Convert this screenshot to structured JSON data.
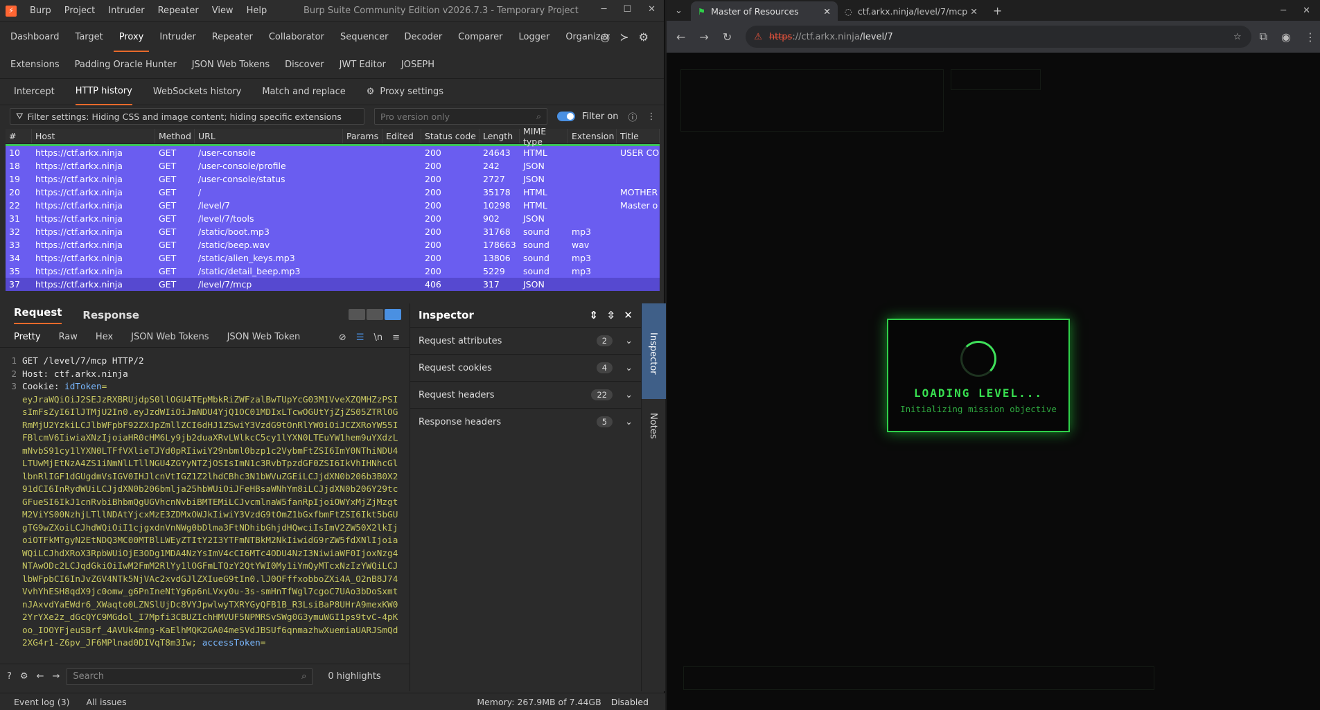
{
  "burp": {
    "title": "Burp Suite Community Edition v2026.7.3 - Temporary Project",
    "menu": [
      "Burp",
      "Project",
      "Intruder",
      "Repeater",
      "View",
      "Help"
    ],
    "main_tabs": [
      "Dashboard",
      "Target",
      "Proxy",
      "Intruder",
      "Repeater",
      "Collaborator",
      "Sequencer",
      "Decoder",
      "Comparer",
      "Logger",
      "Organizer"
    ],
    "ext_tabs": [
      "Extensions",
      "Padding Oracle Hunter",
      "JSON Web Tokens",
      "Discover",
      "JWT Editor",
      "JOSEPH"
    ],
    "proxy_tabs": [
      "Intercept",
      "HTTP history",
      "WebSockets history",
      "Match and replace",
      "Proxy settings"
    ],
    "filter_text": "Filter settings: Hiding CSS and image content; hiding specific extensions",
    "pro_placeholder": "Pro version only",
    "filter_on": "Filter on",
    "columns": [
      "#",
      "Host",
      "Method",
      "URL",
      "Params",
      "Edited",
      "Status code",
      "Length",
      "MIME type",
      "Extension",
      "Title"
    ],
    "rows": [
      [
        "10",
        "https://ctf.arkx.ninja",
        "GET",
        "/user-console",
        "",
        "",
        "200",
        "24643",
        "HTML",
        "",
        "USER CO"
      ],
      [
        "18",
        "https://ctf.arkx.ninja",
        "GET",
        "/user-console/profile",
        "",
        "",
        "200",
        "242",
        "JSON",
        "",
        ""
      ],
      [
        "19",
        "https://ctf.arkx.ninja",
        "GET",
        "/user-console/status",
        "",
        "",
        "200",
        "2727",
        "JSON",
        "",
        ""
      ],
      [
        "20",
        "https://ctf.arkx.ninja",
        "GET",
        "/",
        "",
        "",
        "200",
        "35178",
        "HTML",
        "",
        "MOTHER"
      ],
      [
        "22",
        "https://ctf.arkx.ninja",
        "GET",
        "/level/7",
        "",
        "",
        "200",
        "10298",
        "HTML",
        "",
        "Master o"
      ],
      [
        "31",
        "https://ctf.arkx.ninja",
        "GET",
        "/level/7/tools",
        "",
        "",
        "200",
        "902",
        "JSON",
        "",
        ""
      ],
      [
        "32",
        "https://ctf.arkx.ninja",
        "GET",
        "/static/boot.mp3",
        "",
        "",
        "200",
        "31768",
        "sound",
        "mp3",
        ""
      ],
      [
        "33",
        "https://ctf.arkx.ninja",
        "GET",
        "/static/beep.wav",
        "",
        "",
        "200",
        "178663",
        "sound",
        "wav",
        ""
      ],
      [
        "34",
        "https://ctf.arkx.ninja",
        "GET",
        "/static/alien_keys.mp3",
        "",
        "",
        "200",
        "13806",
        "sound",
        "mp3",
        ""
      ],
      [
        "35",
        "https://ctf.arkx.ninja",
        "GET",
        "/static/detail_beep.mp3",
        "",
        "",
        "200",
        "5229",
        "sound",
        "mp3",
        ""
      ],
      [
        "37",
        "https://ctf.arkx.ninja",
        "GET",
        "/level/7/mcp",
        "",
        "",
        "406",
        "317",
        "JSON",
        "",
        ""
      ]
    ],
    "req_tabs": [
      "Request",
      "Response"
    ],
    "format_tabs": [
      "Pretty",
      "Raw",
      "Hex",
      "JSON Web Tokens",
      "JSON Web Token"
    ],
    "code_lines": {
      "l1": "GET /level/7/mcp HTTP/2",
      "l2": "Host: ctf.arkx.ninja",
      "l3k": "Cookie: ",
      "l3n": "idToken",
      "l3v": "=\neyJraWQiOiJ2SEJzRXBRUjdpS0llOGU4TEpMbkRiZWFzalBwTUpYcG03M1VveXZQMHZzPSIsImFsZyI6IlJTMjU2In0.eyJzdWIiOiJmNDU4YjQ1OC01MDIxLTcwOGUtYjZjZS05ZTRlOGRmMjU2YzkiLCJlbWFpbF92ZXJpZmllZCI6dHJ1ZSwiY3VzdG9tOnRlYW0iOiJCZXRoYW55IFBlcmV6IiwiaXNzIjoiaHR0cHM6Ly9jb2duaXRvLWlkcC5cy1lYXN0LTEuYW1hem9uYXdzLmNvbS91cy1lYXN0LTFfVXlieTJYd0pRIiwiY29nbml0bzp1c2VybmFtZSI6ImY0NThiNDU4LTUwMjEtNzA4ZS1iNmNlLTllNGU4ZGYyNTZjOSIsImN1c3RvbTpzdGF0ZSI6IkVhIHNhcGllbnRlIGF1dGUgdmVsIGV0IHJlcnVtIGZ1Z2lhdCBhc3N1bWVuZGEiLCJjdXN0b206b3B0X291dCI6InRydWUiLCJjdXN0b206bmlja25hbWUiOiJFeHBsaWNhYm8iLCJjdXN0b206Y29tcGFueSI6IkJ1cnRvbiBhbmQgUGVhcnNvbiBMTEMiLCJvcmlnaW5fanRpIjoiOWYxMjZjMzgtM2ViYS00NzhjLTllNDAtYjcxMzE3ZDMxOWJkIiwiY3VzdG9tOmZ1bGxfbmFtZSI6Ikt5bGUgTG9wZXoiLCJhdWQiOiI1cjgxdnVnNWg0bDlma3FtNDhibGhjdHQwciIsImV2ZW50X2lkIjoiOTFkMTgyN2EtNDQ3MC00MTBlLWEyZTItY2I3YTFmNTBkM2NkIiwidG9rZW5fdXNlIjoiaWQiLCJhdXRoX3RpbWUiOjE3ODg1MDA4NzYsImV4cCI6MTc4ODU4NzI3NiwiaWF0IjoxNzg4NTAwODc2LCJqdGkiOiIwM2FmM2RlYy1lOGFmLTQzY2QtYWI0My1iYmQyMTcxNzIzYWQiLCJlbWFpbCI6InJvZGV4NTk5NjVAc2xvdGJlZXIueG9tIn0.lJ0OFffxobboZXi4A_O2nB8J74VvhYhESH8qdX9jc0omw_g6PnIneNtYg6p6nLVxy0u-3s-smHnTfWgl7cgoC7UAo3bDoSxmtnJAxvdYaEWdr6_XWaqto0LZNSlUjDc8VYJpwlwyTXRYGyQFB1B_R3LsiBaP8UHrA9mexKW02YrYXe2z_dGcQYC9MGdol_I7Mpfi3CBUZIchHMVUF5NPMRSvSWg0G3ymuWGI1ps9tvC-4pKoo_IOOYFjeuSBrf_4AVUk4mng-KaElhMQK2GA04meSVdJBSUf6qnmazhwXuemiaUARJSmQd2XG4r1-Z6pv_JF6MPlnad0DIVqT8m3Iw; ",
      "l3n2": "accessToken",
      "l3v2": "="
    },
    "search_placeholder": "Search",
    "highlights": "0 highlights",
    "inspector": {
      "title": "Inspector",
      "rows": [
        {
          "label": "Request attributes",
          "count": "2"
        },
        {
          "label": "Request cookies",
          "count": "4"
        },
        {
          "label": "Request headers",
          "count": "22"
        },
        {
          "label": "Response headers",
          "count": "5"
        }
      ]
    },
    "strip": {
      "inspector": "Inspector",
      "notes": "Notes"
    },
    "status": {
      "event_log": "Event log (3)",
      "issues": "All issues",
      "memory": "Memory: 267.9MB of 7.44GB",
      "disabled": "Disabled"
    }
  },
  "browser": {
    "tab1": "Master of Resources",
    "tab2": "ctf.arkx.ninja/level/7/mcp",
    "url_scheme": "https",
    "url_host": "://ctf.arkx.ninja",
    "url_path": "/level/7",
    "loading_title": "LOADING LEVEL...",
    "loading_sub": "Initializing mission objective"
  },
  "colors": {
    "accent": "#e86a2b",
    "row": "#6a5df0",
    "green": "#38e050"
  }
}
